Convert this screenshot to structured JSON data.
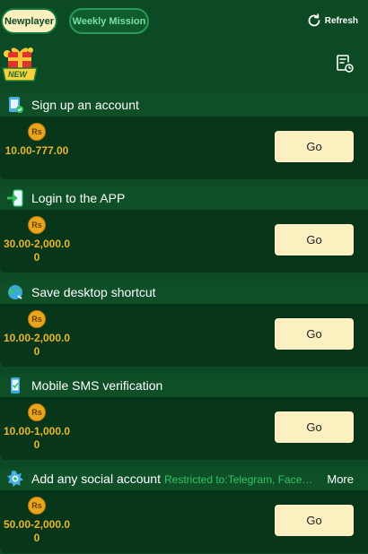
{
  "tabs": [
    {
      "label": "Newplayer",
      "active": true
    },
    {
      "label": "Weekly Mission",
      "active": false
    }
  ],
  "refresh_label": "Refresh",
  "badge_new": "NEW",
  "coin_symbol": "Rs",
  "tasks": [
    {
      "title": "Sign up an account",
      "amount": "10.00-777.00",
      "button": "Go",
      "icon": "signup-icon"
    },
    {
      "title": "Login to the APP",
      "amount": "30.00-2,000.00",
      "button": "Go",
      "icon": "login-icon"
    },
    {
      "title": "Save desktop shortcut",
      "amount": "10.00-2,000.00",
      "button": "Go",
      "icon": "globe-icon"
    },
    {
      "title": "Mobile SMS verification",
      "amount": "10.00-1,000.00",
      "button": "Go",
      "icon": "phone-icon"
    },
    {
      "title": "Add any social account",
      "restriction": "Restricted to:Telegram, Facebook",
      "more": "More",
      "amount": "50.00-2,000.00",
      "button": "Go",
      "icon": "social-icon"
    }
  ],
  "colors": {
    "background": "#0b4a24",
    "header": "#0f4f27",
    "card": "#08361a",
    "button": "#fdf0c0",
    "amount": "#e9b62b",
    "coin": "#e9a51c"
  }
}
